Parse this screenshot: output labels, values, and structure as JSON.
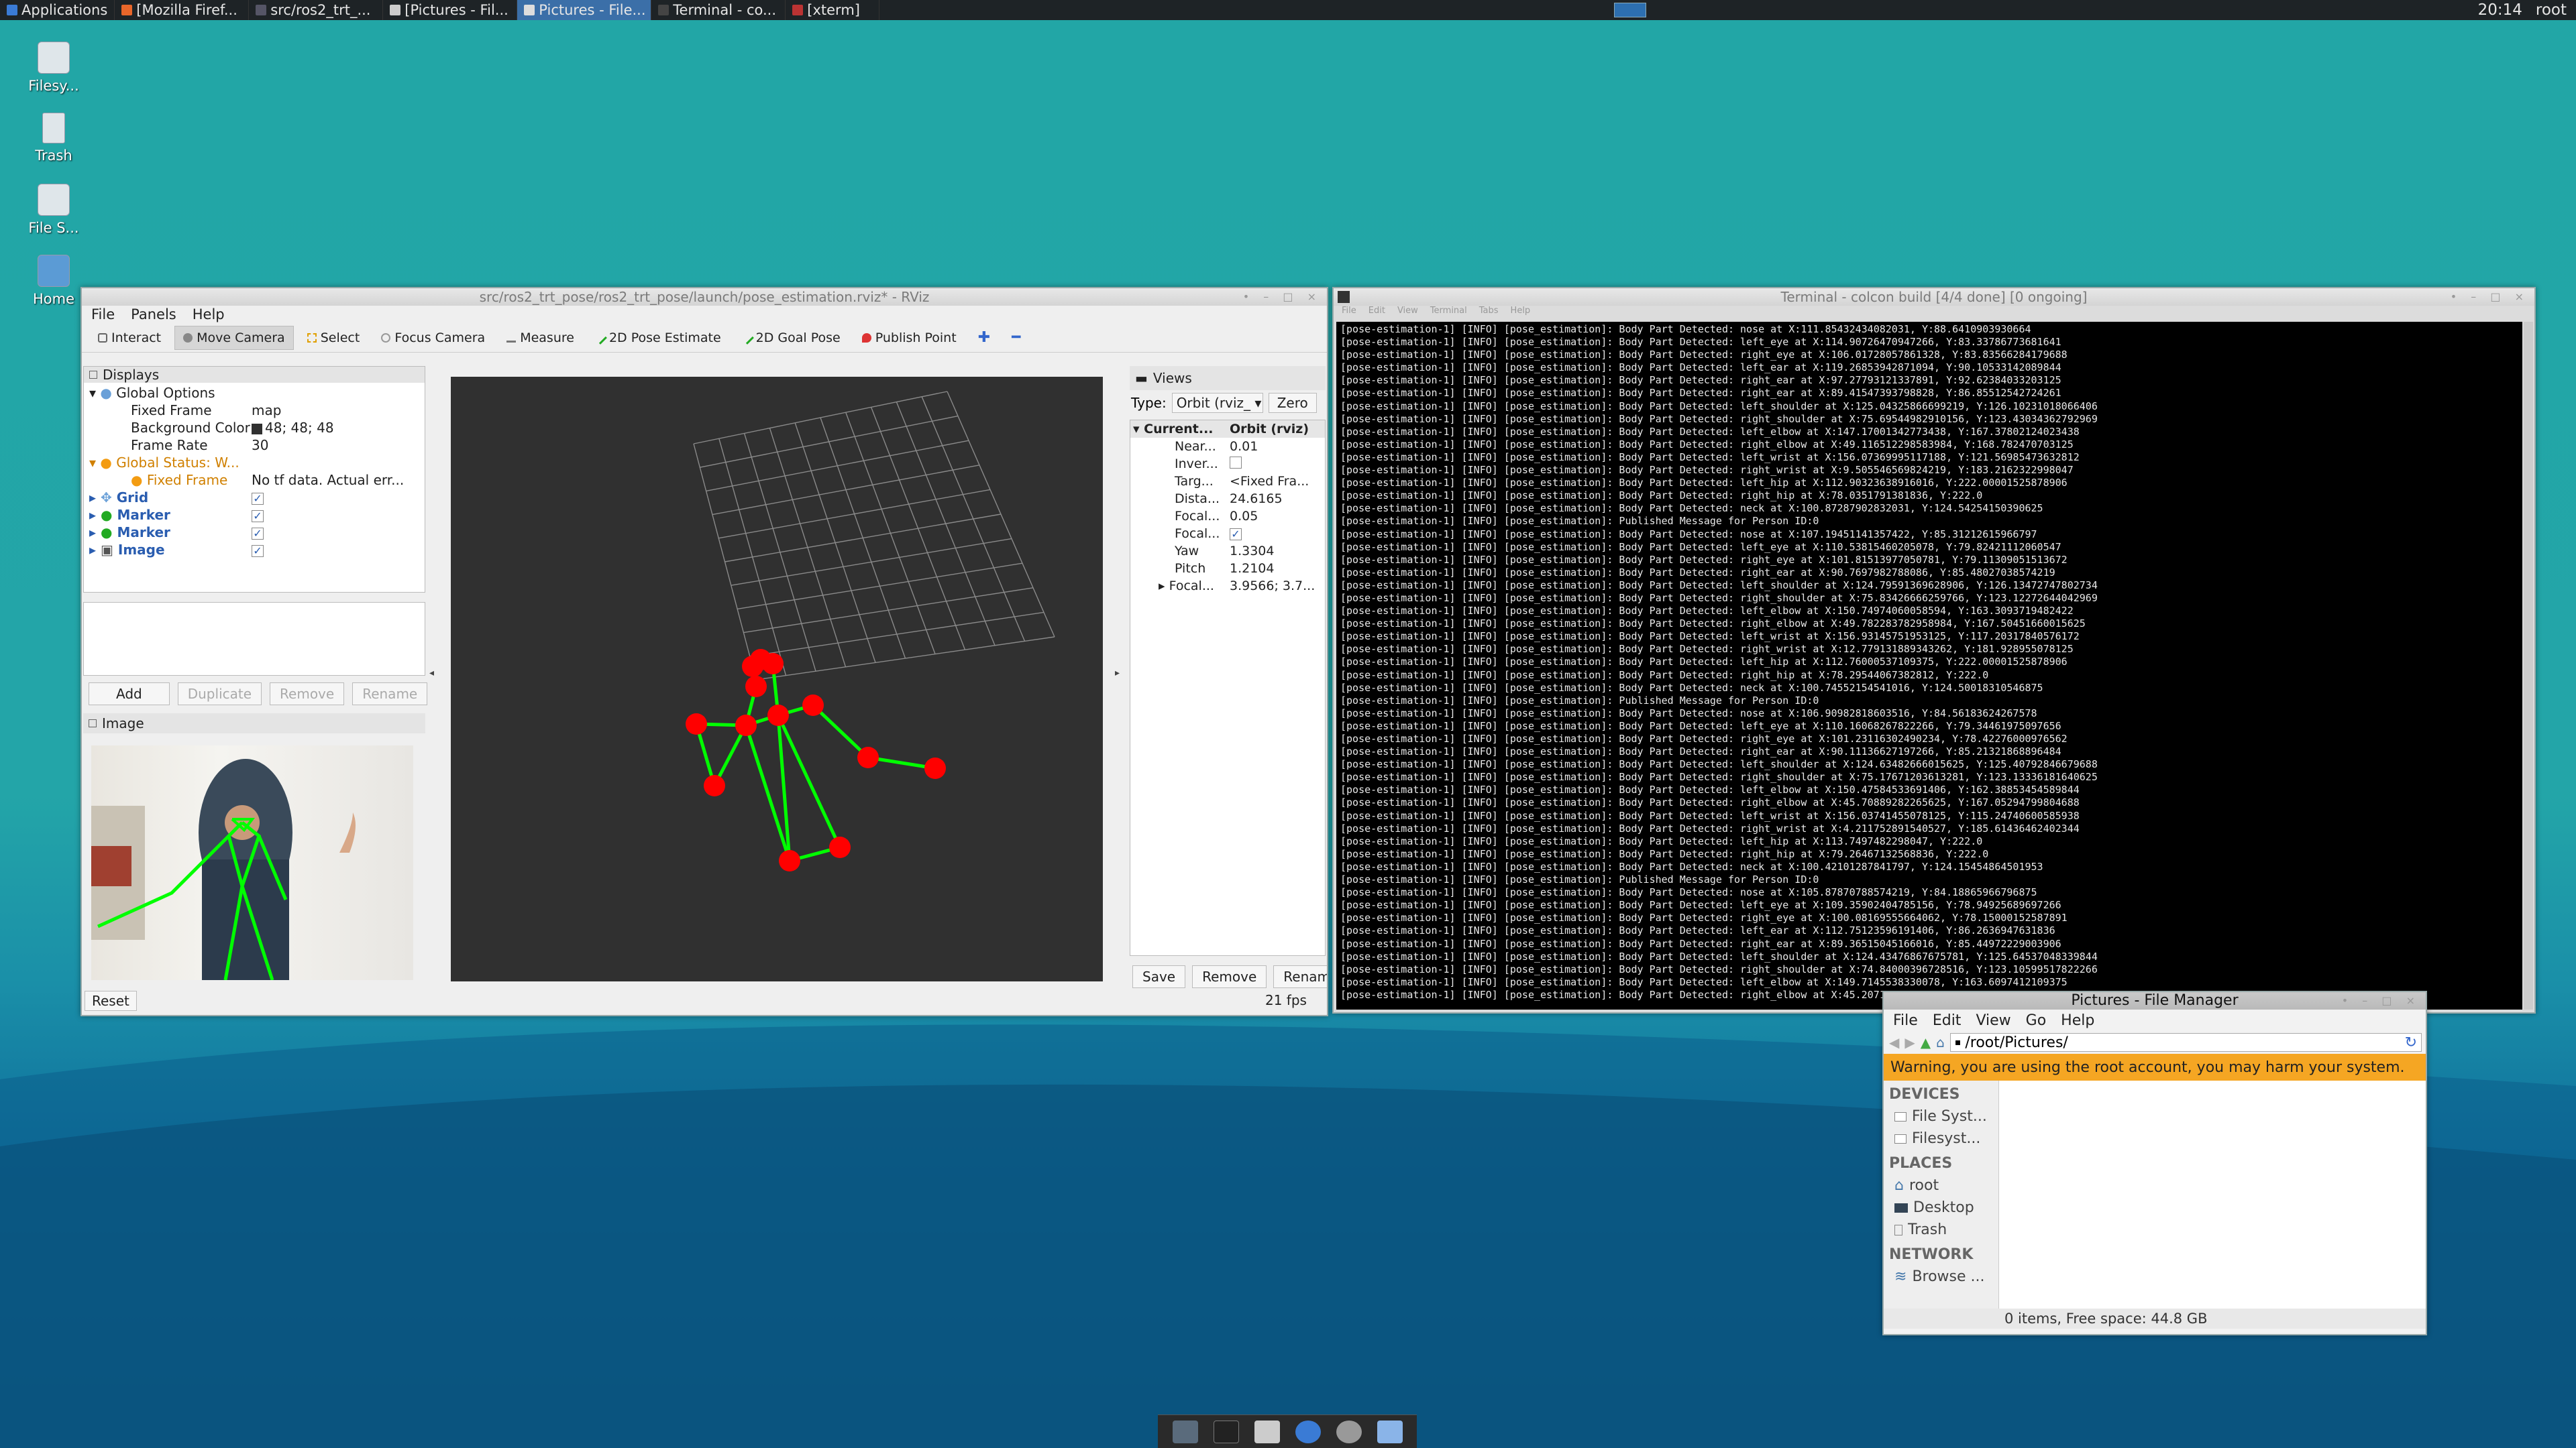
{
  "taskbar": {
    "apps_label": "Applications",
    "windows": [
      {
        "label": "[Mozilla Firef...",
        "active": false
      },
      {
        "label": "src/ros2_trt_...",
        "active": false
      },
      {
        "label": "[Pictures - Fil...",
        "active": false
      },
      {
        "label": "Pictures - File...",
        "active": true
      },
      {
        "label": "Terminal - co...",
        "active": false
      },
      {
        "label": "[xterm]",
        "active": false
      }
    ],
    "clock": "20:14",
    "user": "root"
  },
  "desktop_icons": [
    {
      "label": "Filesy...",
      "icon": "drive-icon"
    },
    {
      "label": "Trash",
      "icon": "trash-icon"
    },
    {
      "label": "File S...",
      "icon": "drive-icon"
    },
    {
      "label": "Home",
      "icon": "home-folder-icon"
    }
  ],
  "rviz": {
    "title": "src/ros2_trt_pose/ros2_trt_pose/launch/pose_estimation.rviz* - RViz",
    "menu": [
      "File",
      "Panels",
      "Help"
    ],
    "tools": [
      "Interact",
      "Move Camera",
      "Select",
      "Focus Camera",
      "Measure",
      "2D Pose Estimate",
      "2D Goal Pose",
      "Publish Point"
    ],
    "displays_title": "Displays",
    "displays": [
      {
        "name": "Global Options",
        "value": ""
      },
      {
        "name": "Fixed Frame",
        "value": "map"
      },
      {
        "name": "Background Color",
        "value": "48; 48; 48"
      },
      {
        "name": "Frame Rate",
        "value": "30"
      },
      {
        "name": "Global Status: W...",
        "value": ""
      },
      {
        "name": "Fixed Frame",
        "value": "No tf data.  Actual err..."
      },
      {
        "name": "Grid",
        "value": "✓"
      },
      {
        "name": "Marker",
        "value": "✓"
      },
      {
        "name": "Marker",
        "value": "✓"
      },
      {
        "name": "Image",
        "value": "✓"
      }
    ],
    "display_buttons": [
      "Add",
      "Duplicate",
      "Remove",
      "Rename"
    ],
    "image_panel_title": "Image",
    "reset_label": "Reset",
    "views_title": "Views",
    "type_label": "Type:",
    "type_value": "Orbit (rviz_",
    "zero_label": "Zero",
    "views_props": [
      {
        "name": "Current...",
        "value": "Orbit (rviz)"
      },
      {
        "name": "Near...",
        "value": "0.01"
      },
      {
        "name": "Inver...",
        "value": ""
      },
      {
        "name": "Targ...",
        "value": "<Fixed Fra..."
      },
      {
        "name": "Dista...",
        "value": "24.6165"
      },
      {
        "name": "Focal...",
        "value": "0.05"
      },
      {
        "name": "Focal...",
        "value": "✓"
      },
      {
        "name": "Yaw",
        "value": "1.3304"
      },
      {
        "name": "Pitch",
        "value": "1.2104"
      },
      {
        "name": "Focal...",
        "value": "3.9566; 3.7..."
      }
    ],
    "view_buttons": [
      "Save",
      "Remove",
      "Rename"
    ],
    "fps": "21 fps"
  },
  "terminal": {
    "title": "Terminal - colcon build [4/4 done] [0 ongoing]",
    "menu": [
      "File",
      "Edit",
      "View",
      "Terminal",
      "Tabs",
      "Help"
    ],
    "lines": [
      "[pose-estimation-1] [INFO] [pose_estimation]: Body Part Detected: nose at X:111.85432434082031, Y:88.6410903930664",
      "[pose-estimation-1] [INFO] [pose_estimation]: Body Part Detected: left_eye at X:114.90726470947266, Y:83.33786773681641",
      "[pose-estimation-1] [INFO] [pose_estimation]: Body Part Detected: right_eye at X:106.01728057861328, Y:83.83566284179688",
      "[pose-estimation-1] [INFO] [pose_estimation]: Body Part Detected: left_ear at X:119.26853942871094, Y:90.10533142089844",
      "[pose-estimation-1] [INFO] [pose_estimation]: Body Part Detected: right_ear at X:97.27793121337891, Y:92.62384033203125",
      "[pose-estimation-1] [INFO] [pose_estimation]: Body Part Detected: right_ear at X:89.41547393798828, Y:86.85512542724261",
      "[pose-estimation-1] [INFO] [pose_estimation]: Body Part Detected: left_shoulder at X:125.04325866699219, Y:126.10231018066406",
      "[pose-estimation-1] [INFO] [pose_estimation]: Body Part Detected: right_shoulder at X:75.69544982910156, Y:123.43034362792969",
      "[pose-estimation-1] [INFO] [pose_estimation]: Body Part Detected: left_elbow at X:147.17001342773438, Y:167.37802124023438",
      "[pose-estimation-1] [INFO] [pose_estimation]: Body Part Detected: right_elbow at X:49.116512298583984, Y:168.782470703125",
      "[pose-estimation-1] [INFO] [pose_estimation]: Body Part Detected: left_wrist at X:156.07369995117188, Y:121.56985473632812",
      "[pose-estimation-1] [INFO] [pose_estimation]: Body Part Detected: right_wrist at X:9.505546569824219, Y:183.2162322998047",
      "[pose-estimation-1] [INFO] [pose_estimation]: Body Part Detected: left_hip at X:112.90323638916016, Y:222.00001525878906",
      "[pose-estimation-1] [INFO] [pose_estimation]: Body Part Detected: right_hip at X:78.0351791381836, Y:222.0",
      "[pose-estimation-1] [INFO] [pose_estimation]: Body Part Detected: neck at X:100.87287902832031, Y:124.54254150390625",
      "[pose-estimation-1] [INFO] [pose_estimation]: Published Message for Person ID:0",
      "[pose-estimation-1] [INFO] [pose_estimation]: Body Part Detected: nose at X:107.19451141357422, Y:85.31212615966797",
      "[pose-estimation-1] [INFO] [pose_estimation]: Body Part Detected: left_eye at X:110.53815460205078, Y:79.82421112060547",
      "[pose-estimation-1] [INFO] [pose_estimation]: Body Part Detected: right_eye at X:101.81513977050781, Y:79.11309051513672",
      "[pose-estimation-1] [INFO] [pose_estimation]: Body Part Detected: right_ear at X:90.7697982788086, Y:85.48027038574219",
      "[pose-estimation-1] [INFO] [pose_estimation]: Body Part Detected: left_shoulder at X:124.79591369628906, Y:126.13472747802734",
      "[pose-estimation-1] [INFO] [pose_estimation]: Body Part Detected: right_shoulder at X:75.83426666259766, Y:123.12272644042969",
      "[pose-estimation-1] [INFO] [pose_estimation]: Body Part Detected: left_elbow at X:150.74974060058594, Y:163.3093719482422",
      "[pose-estimation-1] [INFO] [pose_estimation]: Body Part Detected: right_elbow at X:49.782283782958984, Y:167.50451660015625",
      "[pose-estimation-1] [INFO] [pose_estimation]: Body Part Detected: left_wrist at X:156.93145751953125, Y:117.20317840576172",
      "[pose-estimation-1] [INFO] [pose_estimation]: Body Part Detected: right_wrist at X:12.779131889343262, Y:181.928955078125",
      "[pose-estimation-1] [INFO] [pose_estimation]: Body Part Detected: left_hip at X:112.76000537109375, Y:222.00001525878906",
      "[pose-estimation-1] [INFO] [pose_estimation]: Body Part Detected: right_hip at X:78.29544067382812, Y:222.0",
      "[pose-estimation-1] [INFO] [pose_estimation]: Body Part Detected: neck at X:100.74552154541016, Y:124.50018310546875",
      "[pose-estimation-1] [INFO] [pose_estimation]: Published Message for Person ID:0",
      "[pose-estimation-1] [INFO] [pose_estimation]: Body Part Detected: nose at X:106.90982818603516, Y:84.56183624267578",
      "[pose-estimation-1] [INFO] [pose_estimation]: Body Part Detected: left_eye at X:110.16068267822266, Y:79.34461975097656",
      "[pose-estimation-1] [INFO] [pose_estimation]: Body Part Detected: right_eye at X:101.23116302490234, Y:78.42276000976562",
      "[pose-estimation-1] [INFO] [pose_estimation]: Body Part Detected: right_ear at X:90.11136627197266, Y:85.21321868896484",
      "[pose-estimation-1] [INFO] [pose_estimation]: Body Part Detected: left_shoulder at X:124.63482666015625, Y:125.40792846679688",
      "[pose-estimation-1] [INFO] [pose_estimation]: Body Part Detected: right_shoulder at X:75.17671203613281, Y:123.13336181640625",
      "[pose-estimation-1] [INFO] [pose_estimation]: Body Part Detected: left_elbow at X:150.47584533691406, Y:162.38853454589844",
      "[pose-estimation-1] [INFO] [pose_estimation]: Body Part Detected: right_elbow at X:45.70889282265625, Y:167.05294799804688",
      "[pose-estimation-1] [INFO] [pose_estimation]: Body Part Detected: left_wrist at X:156.03741455078125, Y:115.24740600585938",
      "[pose-estimation-1] [INFO] [pose_estimation]: Body Part Detected: right_wrist at X:4.211752891540527, Y:185.61436462402344",
      "[pose-estimation-1] [INFO] [pose_estimation]: Body Part Detected: left_hip at X:113.7497482298047, Y:222.0",
      "[pose-estimation-1] [INFO] [pose_estimation]: Body Part Detected: right_hip at X:79.26467132568836, Y:222.0",
      "[pose-estimation-1] [INFO] [pose_estimation]: Body Part Detected: neck at X:100.42101287841797, Y:124.15454864501953",
      "[pose-estimation-1] [INFO] [pose_estimation]: Published Message for Person ID:0",
      "[pose-estimation-1] [INFO] [pose_estimation]: Body Part Detected: nose at X:105.87870788574219, Y:84.18865966796875",
      "[pose-estimation-1] [INFO] [pose_estimation]: Body Part Detected: left_eye at X:109.35902404785156, Y:78.94925689697266",
      "[pose-estimation-1] [INFO] [pose_estimation]: Body Part Detected: right_eye at X:100.08169555664062, Y:78.15000152587891",
      "[pose-estimation-1] [INFO] [pose_estimation]: Body Part Detected: left_ear at X:112.75123596191406, Y:86.2636947631836",
      "[pose-estimation-1] [INFO] [pose_estimation]: Body Part Detected: right_ear at X:89.36515045166016, Y:85.44972229003906",
      "[pose-estimation-1] [INFO] [pose_estimation]: Body Part Detected: left_shoulder at X:124.43476867675781, Y:125.64537048339844",
      "[pose-estimation-1] [INFO] [pose_estimation]: Body Part Detected: right_shoulder at X:74.84000396728516, Y:123.10599517822266",
      "[pose-estimation-1] [INFO] [pose_estimation]: Body Part Detected: left_elbow at X:149.7145538330078, Y:163.6097412109375",
      "[pose-estimation-1] [INFO] [pose_estimation]: Body Part Detected: right_elbow at X:45.20718658203125, Y:166.91064453125"
    ]
  },
  "filemanager": {
    "title": "Pictures - File Manager",
    "menu": [
      "File",
      "Edit",
      "View",
      "Go",
      "Help"
    ],
    "path": "/root/Pictures/",
    "warning": "Warning, you are using the root account, you may harm your system.",
    "sections": {
      "devices": "DEVICES",
      "places": "PLACES",
      "network": "NETWORK"
    },
    "devices": [
      "File Syst...",
      "Filesyst..."
    ],
    "places": [
      "root",
      "Desktop",
      "Trash"
    ],
    "network": [
      "Browse ..."
    ],
    "status": "0 items, Free space: 44.8 GB"
  },
  "colors": {
    "desktop_teal": "#22a6a6",
    "rviz_bg": "#303030",
    "marker_red": "#ff0000",
    "skeleton_green": "#00ff00",
    "warning_bar": "#f5a623"
  }
}
